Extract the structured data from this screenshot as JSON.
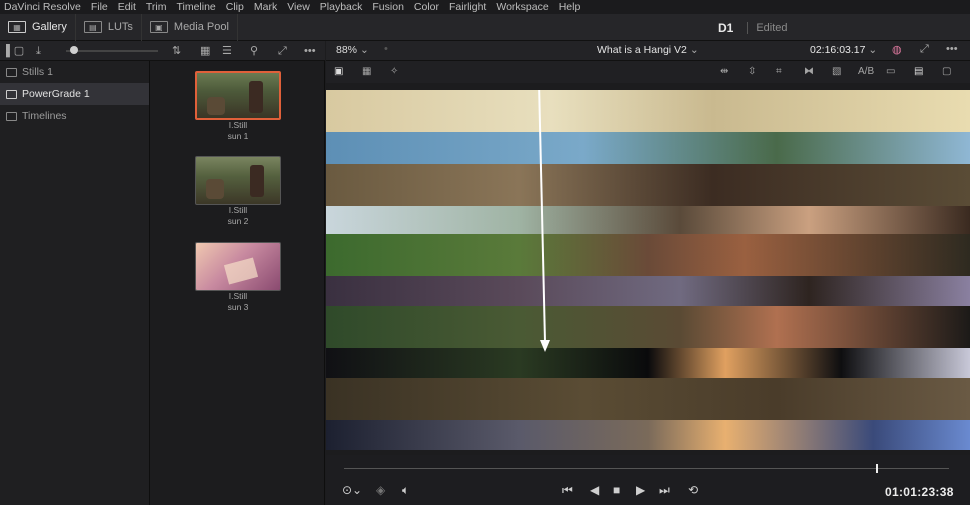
{
  "menu": [
    "DaVinci Resolve",
    "File",
    "Edit",
    "Trim",
    "Timeline",
    "Clip",
    "Mark",
    "View",
    "Playback",
    "Fusion",
    "Color",
    "Fairlight",
    "Workspace",
    "Help"
  ],
  "tabs": [
    {
      "label": "Gallery",
      "icon": "gallery-icon",
      "active": true
    },
    {
      "label": "LUTs",
      "icon": "luts-icon",
      "active": false
    },
    {
      "label": "Media Pool",
      "icon": "media-pool-icon",
      "active": false
    }
  ],
  "project": {
    "name": "D1",
    "status": "Edited"
  },
  "albums": [
    {
      "label": "Stills 1",
      "selected": false
    },
    {
      "label": "PowerGrade 1",
      "selected": true
    },
    {
      "label": "Timelines",
      "selected": false
    }
  ],
  "stills": [
    {
      "line1": "I.Still",
      "line2": "sun 1",
      "selected": true
    },
    {
      "line1": "I.Still",
      "line2": "sun 2",
      "selected": false
    },
    {
      "line1": "I.Still",
      "line2": "sun 3",
      "selected": false
    }
  ],
  "viewer": {
    "zoom": "88%",
    "timeline_name": "What is a Hangi V2",
    "source_timecode": "02:16:03.17",
    "ab_label": "A/B"
  },
  "transport": {
    "timecode": "01:01:23:38"
  },
  "colors": {
    "accent_selected": "#e0603a",
    "background": "#1c1c1e"
  }
}
